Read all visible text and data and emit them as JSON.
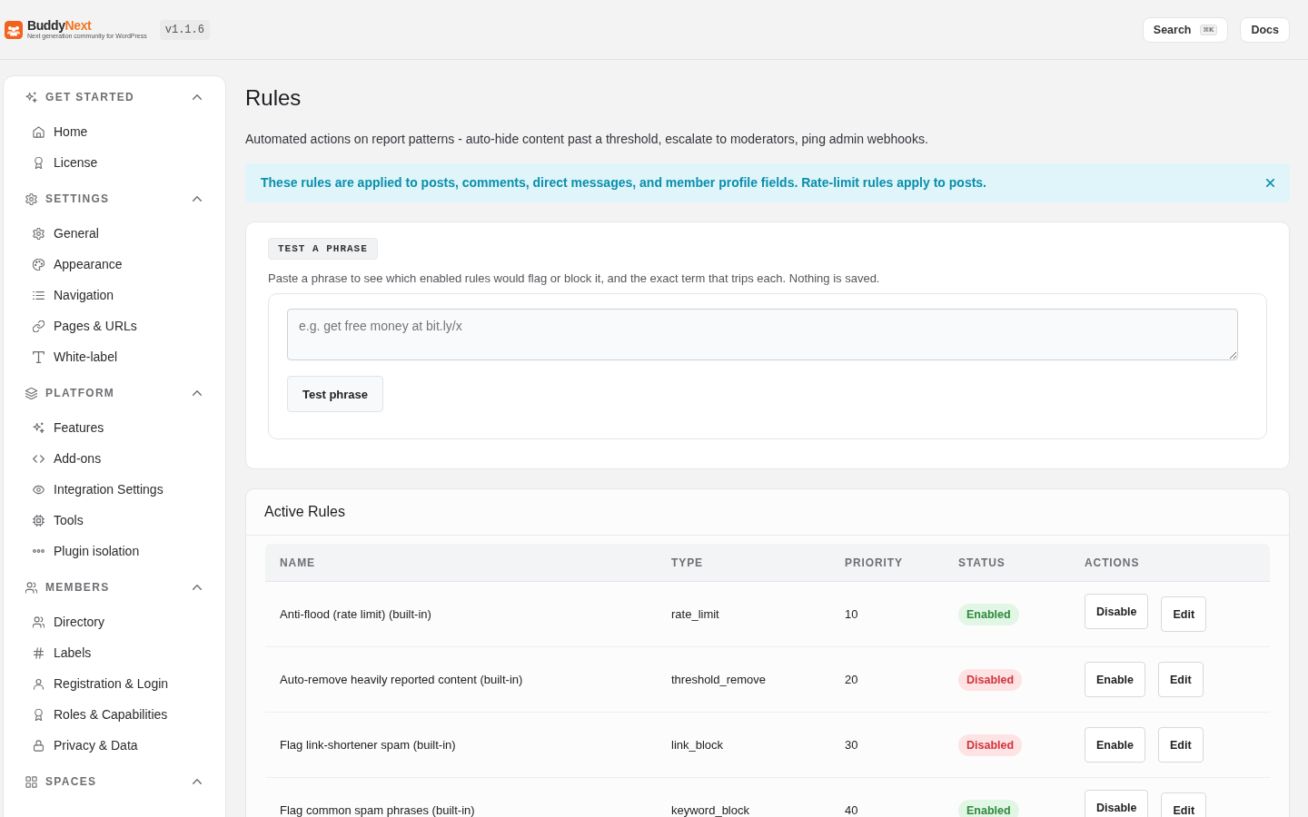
{
  "header": {
    "brand": {
      "first": "Buddy",
      "second": "Next",
      "tagline": "Next generation community for WordPress"
    },
    "version": "v1.1.6",
    "search": {
      "label": "Search",
      "shortcut": "⌘K"
    },
    "docs": "Docs"
  },
  "sidebar": {
    "sections": [
      {
        "title": "GET STARTED",
        "expanded": true,
        "items": [
          "Home",
          "License"
        ]
      },
      {
        "title": "SETTINGS",
        "expanded": true,
        "items": [
          "General",
          "Appearance",
          "Navigation",
          "Pages & URLs",
          "White-label"
        ]
      },
      {
        "title": "PLATFORM",
        "expanded": true,
        "items": [
          "Features",
          "Add-ons",
          "Integration Settings",
          "Tools",
          "Plugin isolation"
        ]
      },
      {
        "title": "MEMBERS",
        "expanded": true,
        "items": [
          "Directory",
          "Labels",
          "Registration & Login",
          "Roles & Capabilities",
          "Privacy & Data"
        ]
      },
      {
        "title": "SPACES",
        "expanded": true
      }
    ]
  },
  "page": {
    "title": "Rules",
    "description": "Automated actions on report patterns - auto-hide content past a threshold, escalate to moderators, ping admin webhooks."
  },
  "notice": {
    "text": "These rules are applied to posts, comments, direct messages, and member profile fields. Rate-limit rules apply to posts."
  },
  "test_phrase": {
    "chip": "TEST A PHRASE",
    "description": "Paste a phrase to see which enabled rules would flag or block it, and the exact term that trips each. Nothing is saved.",
    "input": {
      "placeholder": "e.g. get free money at bit.ly/x"
    },
    "button": "Test phrase"
  },
  "active_rules": {
    "title": "Active Rules",
    "columns": [
      "NAME",
      "TYPE",
      "PRIORITY",
      "STATUS",
      "ACTIONS"
    ],
    "rows": [
      {
        "name": "Anti-flood (rate limit) (built-in)",
        "type": "rate_limit",
        "priority": "10",
        "status": "Enabled",
        "enabled": true,
        "actions": [
          "Disable",
          "Edit"
        ]
      },
      {
        "name": "Auto-remove heavily reported content (built-in)",
        "type": "threshold_remove",
        "priority": "20",
        "status": "Disabled",
        "enabled": false,
        "actions": [
          "Enable",
          "Edit"
        ]
      },
      {
        "name": "Flag link-shortener spam (built-in)",
        "type": "link_block",
        "priority": "30",
        "status": "Disabled",
        "enabled": false,
        "actions": [
          "Enable",
          "Edit"
        ]
      },
      {
        "name": "Flag common spam phrases (built-in)",
        "type": "keyword_block",
        "priority": "40",
        "status": "Enabled",
        "enabled": true,
        "actions": [
          "Disable",
          "Edit"
        ]
      }
    ]
  }
}
